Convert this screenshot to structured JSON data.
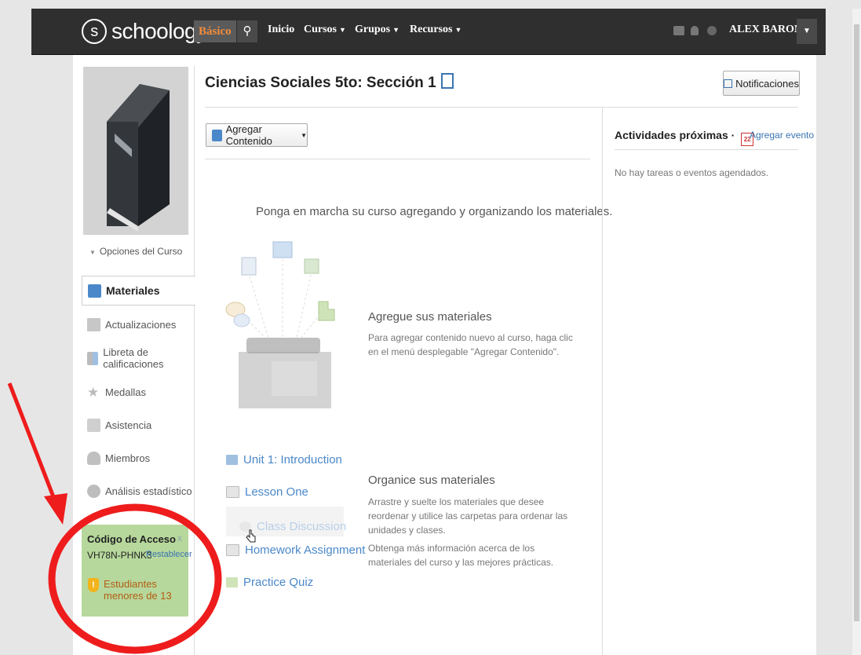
{
  "header": {
    "brand": "schoology",
    "brand_icon_letter": "s",
    "plan_badge": "Básico",
    "nav": [
      {
        "label": "Inicio"
      },
      {
        "label": "Cursos"
      },
      {
        "label": "Grupos"
      },
      {
        "label": "Recursos"
      }
    ],
    "user_name": "ALEX BARONA"
  },
  "sidebar": {
    "course_options": "Opciones del Curso",
    "items": [
      {
        "label": "Materiales",
        "icon": "materials-icon"
      },
      {
        "label": "Actualizaciones",
        "icon": "updates-icon"
      },
      {
        "label": "Libreta de calificaciones",
        "icon": "gradebook-icon"
      },
      {
        "label": "Medallas",
        "icon": "badges-icon"
      },
      {
        "label": "Asistencia",
        "icon": "attendance-icon"
      },
      {
        "label": "Miembros",
        "icon": "members-icon"
      },
      {
        "label": "Análisis estadístico",
        "icon": "analytics-icon"
      }
    ],
    "access_code": {
      "title": "Código de Acceso",
      "close": "x",
      "code": "VH78N-PHNK3",
      "reset_label": "Restablecer",
      "warning": "Estudiantes menores de 13"
    }
  },
  "main": {
    "course_title": "Ciencias Sociales 5to: Sección 1",
    "notifications_label": "Notificaciones",
    "add_content_label": "Agregar Contenido",
    "get_started": "Ponga en marcha su curso agregando y organizando los materiales.",
    "add_materials": {
      "title": "Agregue sus materiales",
      "text": "Para agregar contenido nuevo al curso, haga clic en el menú desplegable \"Agregar Contenido\"."
    },
    "organize_materials": {
      "title": "Organice sus materiales",
      "text1": "Arrastre y suelte los materiales que desee reordenar y utilice las carpetas para ordenar las unidades y clases.",
      "text2": "Obtenga más información acerca de los materiales del curso y las mejores prácticas."
    },
    "sample_materials": [
      {
        "label": "Unit 1: Introduction",
        "icon": "folder-icon"
      },
      {
        "label": "Lesson One",
        "icon": "assignment-icon"
      },
      {
        "label": "Class Discussion",
        "icon": "discussion-icon"
      },
      {
        "label": "Homework Assignment",
        "icon": "assignment-icon"
      },
      {
        "label": "Practice Quiz",
        "icon": "quiz-icon"
      }
    ]
  },
  "upcoming": {
    "title": "Actividades próximas",
    "calendar_day": "22",
    "add_event_label": "Agregar evento",
    "empty_text": "No hay tareas o eventos agendados."
  },
  "colors": {
    "topbar": "#2f2f2f",
    "link": "#4b88c9",
    "access_box": "#b7d89c",
    "annotation_red": "#ee1c1c"
  }
}
